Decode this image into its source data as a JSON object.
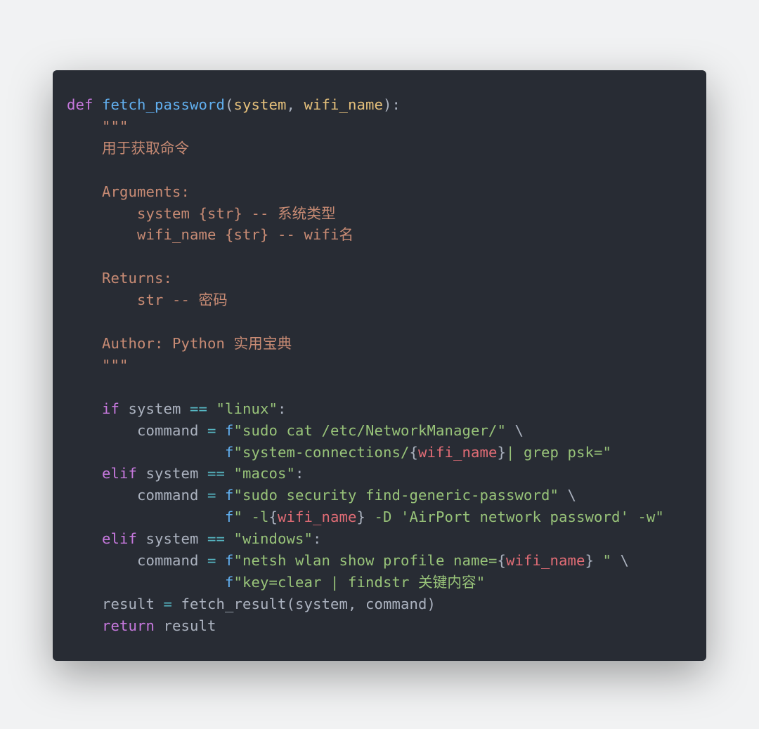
{
  "code": {
    "line01": {
      "def": "def",
      "fname": "fetch_password",
      "p1": "system",
      "p2": "wifi_name"
    },
    "line02": "    \"\"\"",
    "line03": "    用于获取命令",
    "line04": "",
    "line05": "    Arguments:",
    "line06": "        system {str} -- 系统类型",
    "line07": "        wifi_name {str} -- wifi名",
    "line08": "",
    "line09": "    Returns:",
    "line10": "        str -- 密码",
    "line11": "",
    "line12": "    Author: Python 实用宝典",
    "line13": "    \"\"\"",
    "line14": "",
    "line15": {
      "kw": "if",
      "var": "system",
      "op": "==",
      "str": "\"linux\""
    },
    "line16": {
      "lhs": "command",
      "f": "f",
      "s": "\"sudo cat /etc/NetworkManager/\"",
      "cont": "\\"
    },
    "line17": {
      "f": "f",
      "s1": "\"system-connections/",
      "ob": "{",
      "iv": "wifi_name",
      "cb": "}",
      "s2": "| grep psk=\""
    },
    "line18": {
      "kw": "elif",
      "var": "system",
      "op": "==",
      "str": "\"macos\""
    },
    "line19": {
      "lhs": "command",
      "f": "f",
      "s": "\"sudo security find-generic-password\"",
      "cont": "\\"
    },
    "line20": {
      "f": "f",
      "s1": "\" -l",
      "ob": "{",
      "iv": "wifi_name",
      "cb": "}",
      "s2": " -D 'AirPort network password' -w\""
    },
    "line21": {
      "kw": "elif",
      "var": "system",
      "op": "==",
      "str": "\"windows\""
    },
    "line22": {
      "lhs": "command",
      "f": "f",
      "s1": "\"netsh wlan show profile name=",
      "ob": "{",
      "iv": "wifi_name",
      "cb": "}",
      "s2": " \"",
      "cont": "\\"
    },
    "line23": {
      "f": "f",
      "s": "\"key=clear | findstr 关键内容\""
    },
    "line24": {
      "lhs": "result",
      "fn": "fetch_result",
      "a1": "system",
      "a2": "command"
    },
    "line25": {
      "kw": "return",
      "var": "result"
    }
  }
}
